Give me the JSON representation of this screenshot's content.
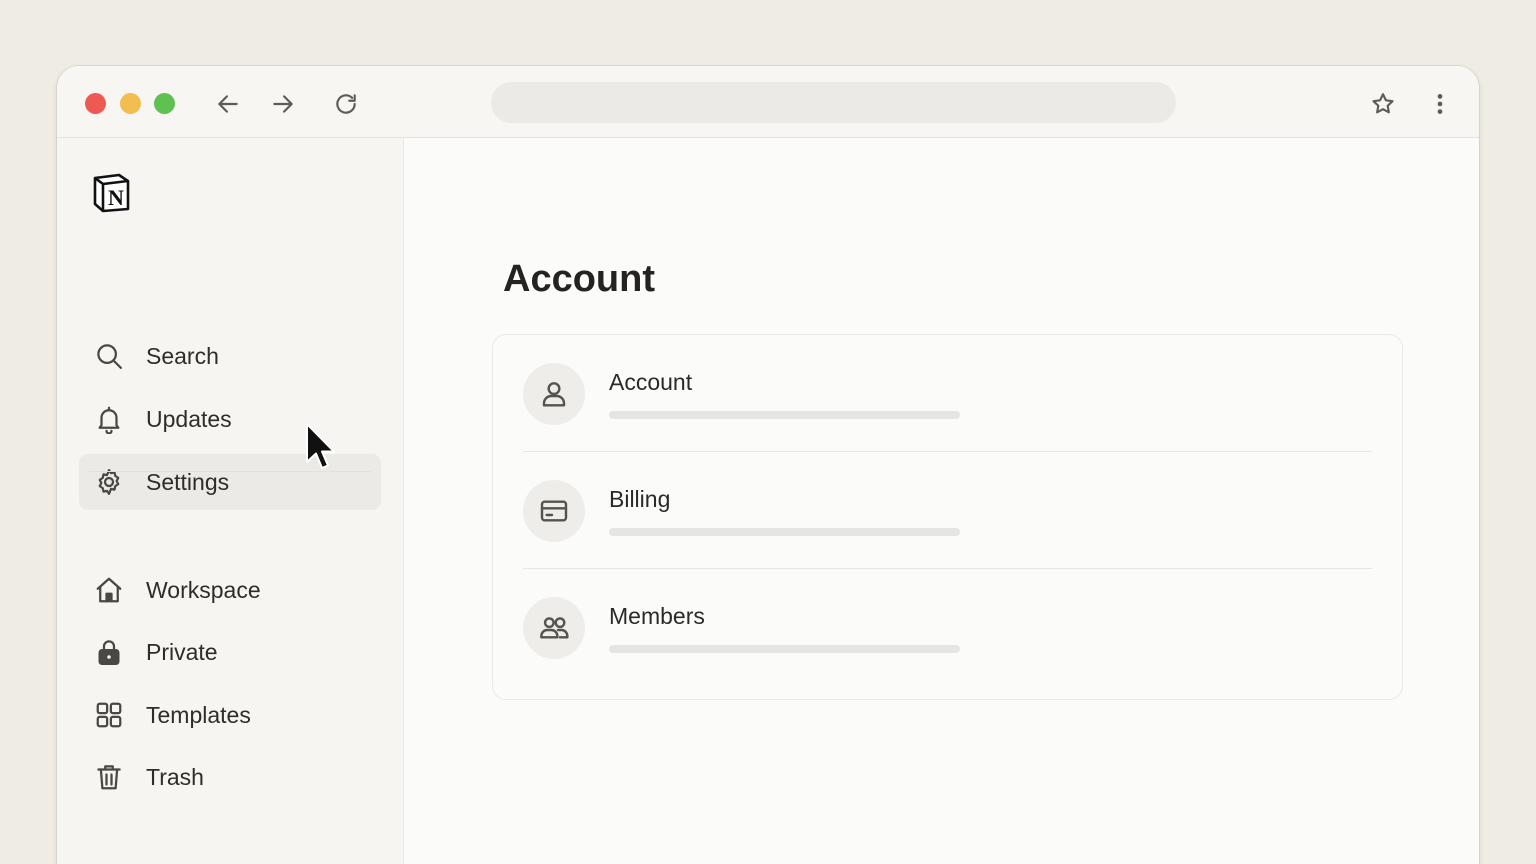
{
  "browser": {
    "url": "",
    "controls": [
      "back-arrow-icon",
      "forward-arrow-icon",
      "reload-icon",
      "star-icon",
      "kebab-menu-icon"
    ]
  },
  "app": {
    "logo": "N"
  },
  "sidebar": {
    "items": [
      {
        "label": "Search",
        "icon": "search-icon",
        "active": false
      },
      {
        "label": "Updates",
        "icon": "bell-icon",
        "active": false
      },
      {
        "label": "Settings",
        "icon": "gear-icon",
        "active": true
      },
      {
        "label": "Workspace",
        "icon": "home-icon",
        "active": false
      },
      {
        "label": "Private",
        "icon": "lock-icon",
        "active": false
      },
      {
        "label": "Templates",
        "icon": "grid-icon",
        "active": false
      },
      {
        "label": "Trash",
        "icon": "trash-icon",
        "active": false
      }
    ]
  },
  "main": {
    "title": "Account",
    "sections": [
      {
        "label": "Account",
        "icon": "user-icon"
      },
      {
        "label": "Billing",
        "icon": "credit-card-icon"
      },
      {
        "label": "Members",
        "icon": "users-icon"
      }
    ]
  },
  "colors": {
    "background": "#efece3",
    "window": "#fbfbfa",
    "sidebar": "#f6f5f2",
    "active_item": "#ebeae6",
    "traffic_red": "#ec5a51",
    "traffic_yellow": "#f1be4f",
    "traffic_green": "#5fc152"
  }
}
